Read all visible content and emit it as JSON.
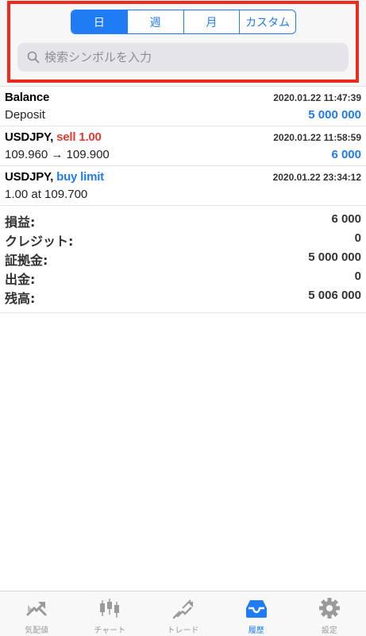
{
  "period_tabs": [
    {
      "label": "日",
      "active": true
    },
    {
      "label": "週",
      "active": false
    },
    {
      "label": "月",
      "active": false
    },
    {
      "label": "カスタム",
      "active": false
    }
  ],
  "search": {
    "placeholder": "検索シンボルを入力",
    "icon": "search-icon"
  },
  "history": [
    {
      "title": "Balance",
      "subtitle": "Deposit",
      "timestamp": "2020.01.22 11:47:39",
      "amount": "5 000 000"
    },
    {
      "symbol": "USDJPY,",
      "action": "sell 1.00",
      "action_color": "#e53a2f",
      "subtitle": "109.960 → 109.900",
      "timestamp": "2020.01.22 11:58:59",
      "amount": "6 000"
    },
    {
      "symbol": "USDJPY,",
      "action": "buy limit",
      "action_color": "#1f7cf4",
      "subtitle": "1.00 at 109.700",
      "timestamp": "2020.01.22 23:34:12"
    }
  ],
  "summary": [
    {
      "label": "損益:",
      "value": "6 000"
    },
    {
      "label": "クレジット:",
      "value": "0"
    },
    {
      "label": "証拠金:",
      "value": "5 000 000"
    },
    {
      "label": "出金:",
      "value": "0"
    },
    {
      "label": "残高:",
      "value": "5 006 000"
    }
  ],
  "tabbar": [
    {
      "label": "気配値",
      "icon": "quotes-icon",
      "active": false
    },
    {
      "label": "チャート",
      "icon": "candlestick-chart-icon",
      "active": false
    },
    {
      "label": "トレード",
      "icon": "trade-icon",
      "active": false
    },
    {
      "label": "履歴",
      "icon": "history-inbox-icon",
      "active": true
    },
    {
      "label": "設定",
      "icon": "gear-icon",
      "active": false
    }
  ],
  "colors": {
    "accent": "#1f7cf4",
    "sell": "#e53a2f",
    "highlight": "#ee2a1f"
  }
}
